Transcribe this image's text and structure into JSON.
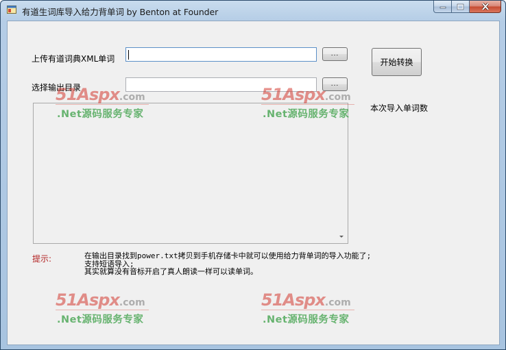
{
  "window": {
    "title": "有道生词库导入给力背单词  by Benton at Founder",
    "caption_buttons": {
      "minimize": "‒",
      "maximize": "□",
      "close": "✕"
    }
  },
  "form": {
    "upload_label": "上传有道词典XML单词",
    "upload_value": "",
    "upload_browse_label": "...",
    "output_label": "选择输出目录",
    "output_value": "",
    "output_browse_label": "...",
    "convert_button_label": "开始转换",
    "import_count_label": "本次导入单词数"
  },
  "hint": {
    "label": "提示:",
    "lines": [
      "在输出目录找到power.txt拷贝到手机存储卡中就可以使用给力背单词的导入功能了;",
      "支持短语导入;",
      "其实就算没有音标开启了真人朗读一样可以读单词。"
    ]
  },
  "watermark": {
    "brand_main": "51Aspx",
    "brand_domain": ".com",
    "tagline": ".Net源码服务专家"
  },
  "colors": {
    "hint_label": "#b22222",
    "watermark_red": "#d43c32",
    "watermark_green": "#2e9a3a"
  }
}
